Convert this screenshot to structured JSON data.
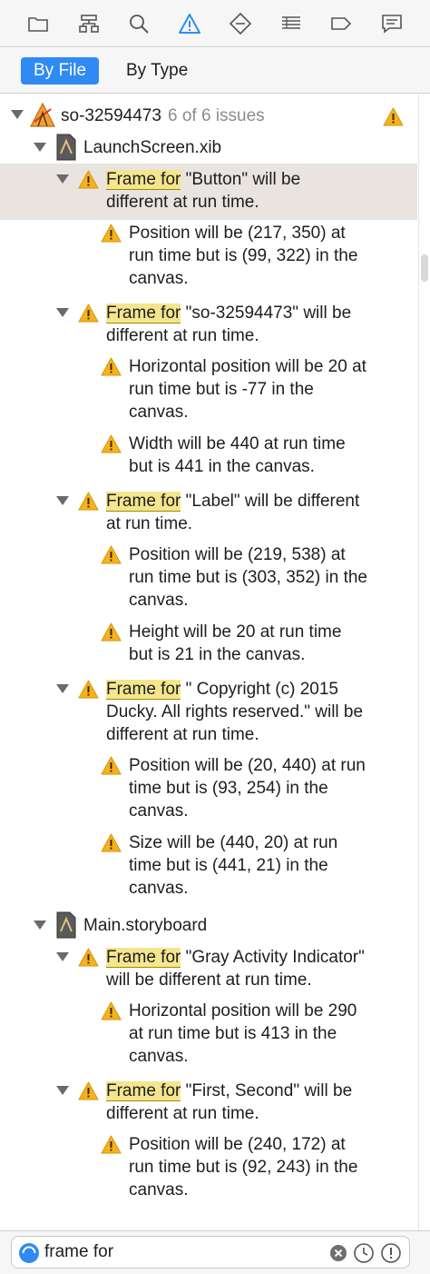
{
  "toolbar": {
    "icons": [
      "folder-icon",
      "hierarchy-icon",
      "search-icon",
      "warning-icon",
      "diamond-icon",
      "list-icon",
      "tag-icon",
      "comment-icon"
    ],
    "active_icon": "warning-icon",
    "accent": "#2f8bf3"
  },
  "segments": {
    "by_file": "By File",
    "by_type": "By Type"
  },
  "project": {
    "name": "so-32594473",
    "count": "6 of 6 issues"
  },
  "files": [
    {
      "name": "LaunchScreen.xib",
      "issues": [
        {
          "prefix": "Frame for",
          "line1": " \"Button\" will be",
          "line2": "different at run time.",
          "details": [
            [
              "Position will be (217, 350) at",
              "run time but is (99, 322) in the",
              "canvas."
            ]
          ]
        },
        {
          "prefix": "Frame for",
          "line1": " \"so-32594473\" will be",
          "line2": "different at run time.",
          "details": [
            [
              "Horizontal position will be 20 at",
              "run time but is -77 in the",
              "canvas."
            ],
            [
              "Width will be 440 at run time",
              "but is 441 in the canvas."
            ]
          ]
        },
        {
          "prefix": "Frame for",
          "line1": " \"Label\" will be different",
          "line2": "at run time.",
          "details": [
            [
              "Position will be (219, 538) at",
              "run time but is (303, 352) in the",
              "canvas."
            ],
            [
              "Height will be 20 at run time",
              "but is 21 in the canvas."
            ]
          ]
        },
        {
          "prefix": "Frame for",
          "line1": " \"  Copyright (c) 2015",
          "line2": "Ducky. All rights reserved.\" will be",
          "line3": "different at run time.",
          "details": [
            [
              "Position will be (20, 440) at run",
              "time but is (93, 254) in the",
              "canvas."
            ],
            [
              "Size will be (440, 20) at run",
              "time but is (441, 21) in the",
              "canvas."
            ]
          ]
        }
      ]
    },
    {
      "name": "Main.storyboard",
      "issues": [
        {
          "prefix": "Frame for",
          "line1": " \"Gray Activity Indicator\"",
          "line2": "will be different at run time.",
          "details": [
            [
              "Horizontal position will be 290",
              "at run time but is 413 in the",
              "canvas."
            ]
          ]
        },
        {
          "prefix": "Frame for",
          "line1": " \"First, Second\" will be",
          "line2": "different at run time.",
          "details": [
            [
              "Position will be (240, 172) at",
              "run time but is (92, 243) in the",
              "canvas."
            ]
          ]
        }
      ]
    }
  ],
  "filter": {
    "value": "frame for"
  }
}
